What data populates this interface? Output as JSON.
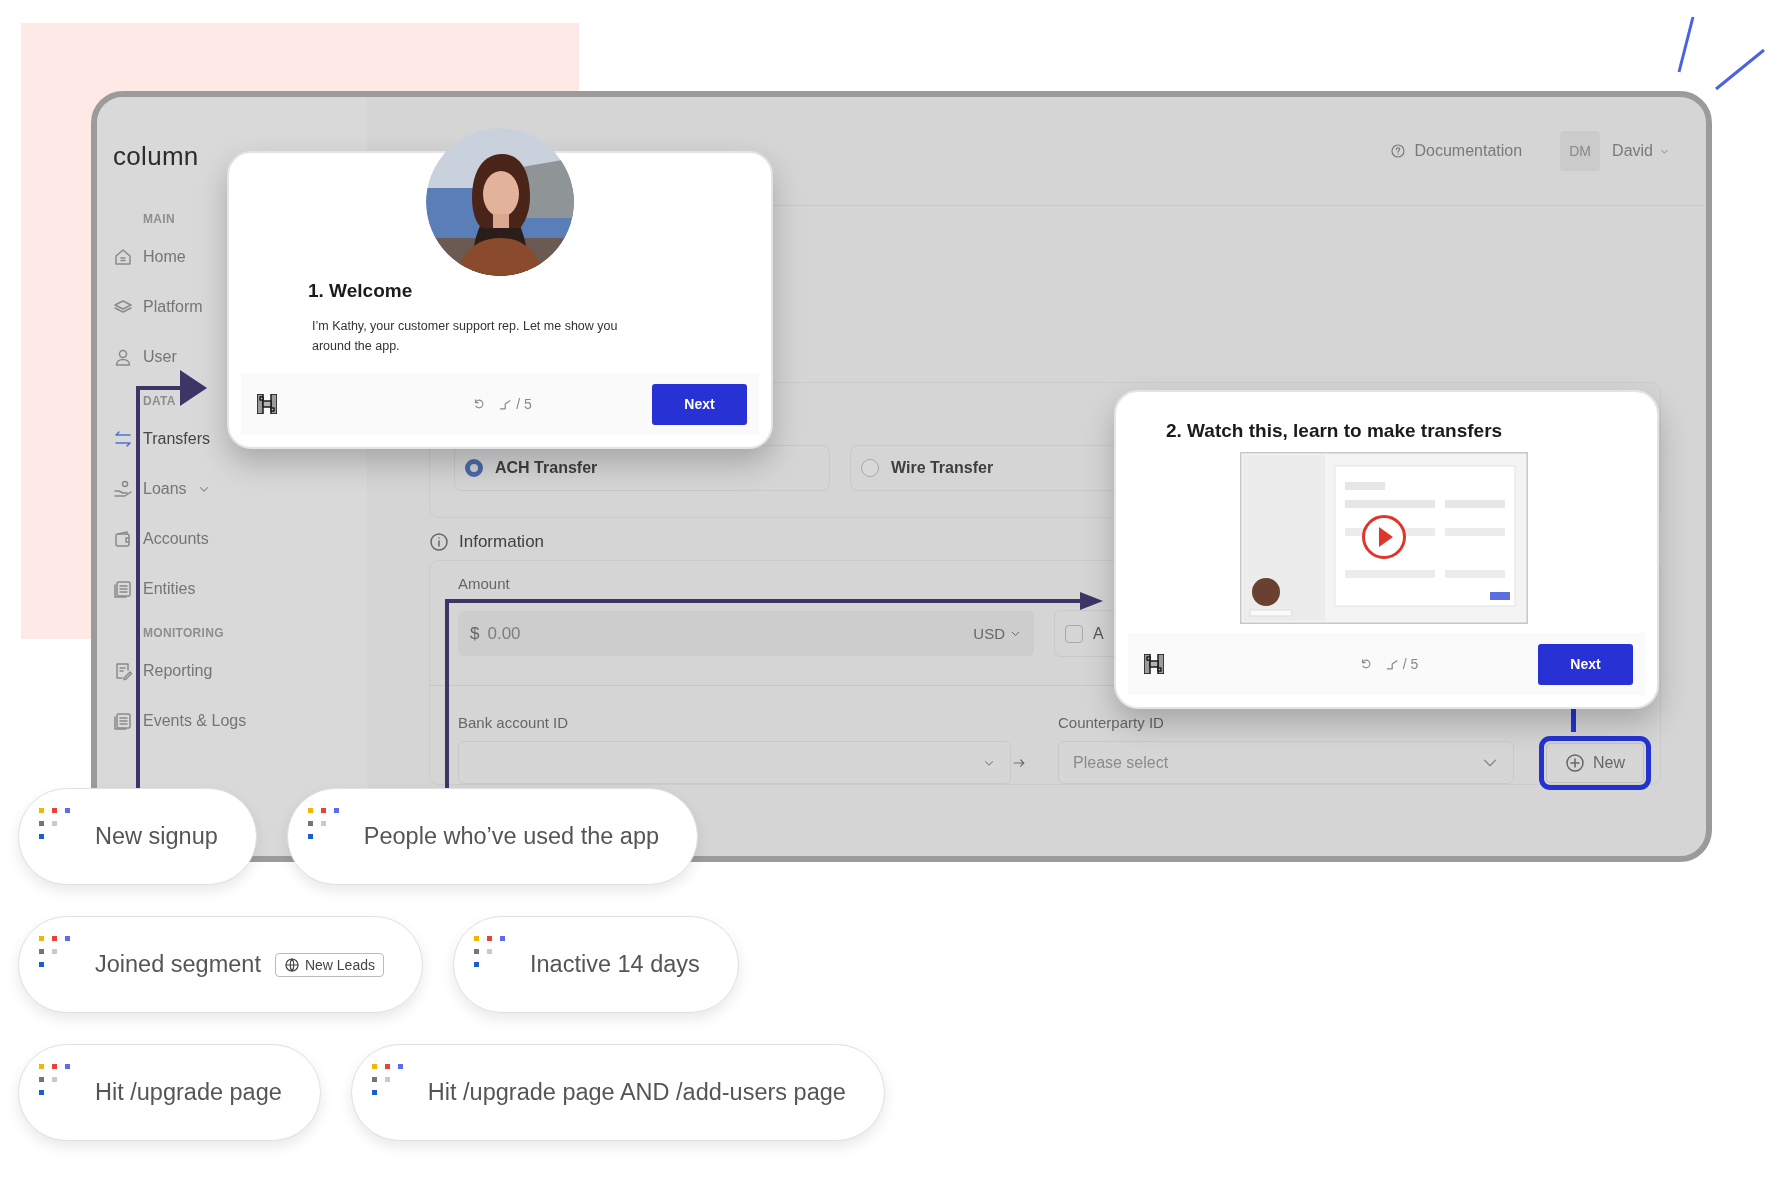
{
  "app": {
    "logo": "column",
    "header": {
      "help_link": "Documentation",
      "user_initials": "DM",
      "user_name": "David"
    },
    "sidebar": [
      {
        "title": "MAIN",
        "items": [
          {
            "label": "Home",
            "selected": false,
            "expandable": false
          },
          {
            "label": "Platform",
            "selected": false,
            "expandable": false
          },
          {
            "label": "User",
            "selected": false,
            "expandable": false
          }
        ]
      },
      {
        "title": "DATA",
        "items": [
          {
            "label": "Transfers",
            "selected": true,
            "expandable": false
          },
          {
            "label": "Loans",
            "selected": false,
            "expandable": true
          },
          {
            "label": "Accounts",
            "selected": false,
            "expandable": false
          },
          {
            "label": "Entities",
            "selected": false,
            "expandable": false
          }
        ]
      },
      {
        "title": "MONITORING",
        "items": [
          {
            "label": "Reporting",
            "selected": false,
            "expandable": false
          },
          {
            "label": "Events & Logs",
            "selected": false,
            "expandable": false
          }
        ]
      }
    ],
    "transfer_types": [
      {
        "label": "ACH Transfer",
        "selected": true
      },
      {
        "label": "Wire Transfer",
        "selected": false
      }
    ],
    "information": {
      "title": "Information",
      "amount": {
        "label": "Amount",
        "currency_symbol": "$",
        "placeholder": "0.00",
        "currency": "USD"
      },
      "checkbox": {
        "label": "A",
        "checked": false
      },
      "bank_account": {
        "label": "Bank account ID"
      },
      "counterparty": {
        "label": "Counterparty ID",
        "placeholder": "Please select"
      },
      "new_button": {
        "label": "New",
        "highlighted": true
      }
    }
  },
  "tour_steps": [
    {
      "kind": "welcome",
      "title": "1. Welcome",
      "body": "I’m Kathy, your customer support rep. Let me show you around the app.",
      "counter": "/ 5",
      "button": "Next"
    },
    {
      "kind": "video",
      "title": "2. Watch this, learn to make transfers",
      "counter": "/ 5",
      "button": "Next"
    }
  ],
  "segments": [
    [
      {
        "label": "New signup"
      },
      {
        "label": "People who’ve used the app"
      }
    ],
    [
      {
        "label": "Joined segment",
        "tag": "New Leads"
      },
      {
        "label": "Inactive 14 days"
      }
    ],
    [
      {
        "label": "Hit /upgrade page"
      },
      {
        "label": "Hit /upgrade page AND /add-users page"
      }
    ]
  ]
}
